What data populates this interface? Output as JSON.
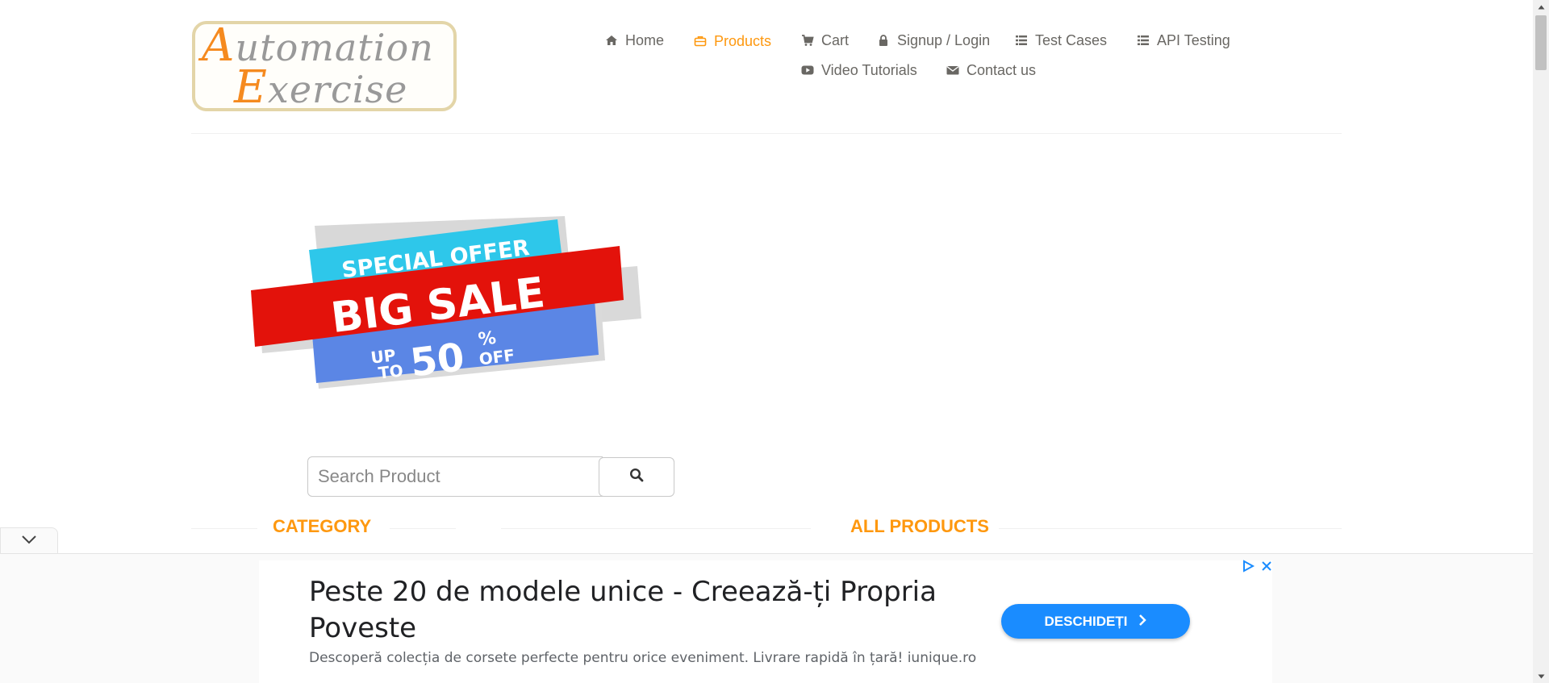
{
  "logo": {
    "line1": "utomation",
    "line2": "xercise",
    "cap1": "A",
    "cap2": "E"
  },
  "nav": {
    "home": "Home",
    "products": "Products",
    "cart": "Cart",
    "signup_login": "Signup / Login",
    "test_cases": "Test Cases",
    "api_testing": "API Testing",
    "video_tutorials": "Video Tutorials",
    "contact_us": "Contact us"
  },
  "banner": {
    "line1": "SPECIAL OFFER",
    "line2": "BIG SALE",
    "line3a": "UP",
    "line3b": "TO",
    "line3c": "50",
    "line3d": "%",
    "line3e": "OFF"
  },
  "search": {
    "placeholder": "Search Product"
  },
  "sections": {
    "category": "CATEGORY",
    "all_products": "ALL PRODUCTS"
  },
  "ad": {
    "headline": "Peste 20 de modele unice - Creează-ți Propria Poveste",
    "description": "Descoperă colecția de corsete perfecte pentru orice eveniment. Livrare rapidă în țară! iunique.ro",
    "cta": "DESCHIDEȚI"
  },
  "colors": {
    "accent": "#fe980f",
    "text": "#696763",
    "cta": "#1a8cff"
  }
}
